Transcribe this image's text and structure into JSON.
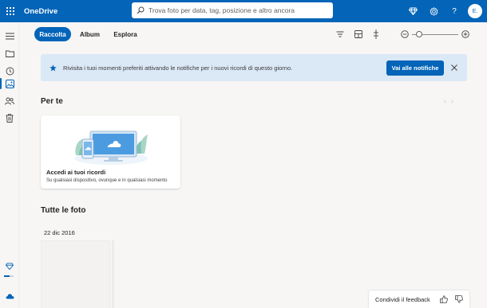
{
  "app": {
    "title": "OneDrive"
  },
  "search": {
    "placeholder": "Trova foto per data, tag, posizione e altro ancora"
  },
  "header": {
    "icons": [
      "premium-diamond-icon",
      "settings-gear-icon",
      "help-icon"
    ],
    "help_label": "?",
    "avatar_initial": "E."
  },
  "tabs": [
    {
      "label": "Raccolta",
      "active": true
    },
    {
      "label": "Album",
      "active": false
    },
    {
      "label": "Esplora",
      "active": false
    }
  ],
  "toolbar": {
    "icons": [
      "filter-icon",
      "view-layout-icon",
      "timeline-icon"
    ],
    "zoom_out_label": "−",
    "zoom_in_label": "+",
    "zoom_level": 0.15
  },
  "banner": {
    "text": "Rivisita i tuoi momenti preferiti attivando le notifiche per i nuovi ricordi di questo giorno.",
    "button_label": "Vai alle notifiche"
  },
  "for_you": {
    "title": "Per te",
    "card": {
      "title": "Accedi ai tuoi ricordi",
      "subtitle": "Su qualsiasi dispositivo, ovunque e in qualsiasi momento"
    }
  },
  "all_photos": {
    "title": "Tutte le foto",
    "date": "22 dic 2016"
  },
  "storage": {
    "used_fraction": 0.6
  },
  "feedback": {
    "label": "Condividi il feedback"
  },
  "colors": {
    "brand_blue": "#0364b8",
    "banner_bg": "#dbe8f5",
    "page_bg": "#f7f6f5"
  }
}
